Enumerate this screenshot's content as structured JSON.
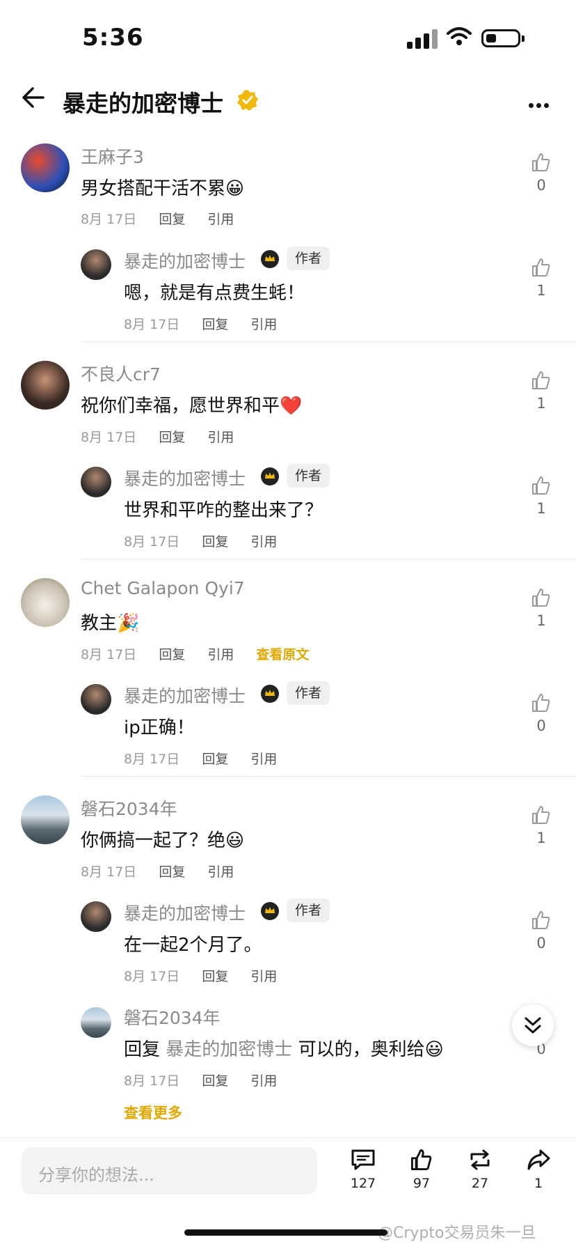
{
  "status_bar": {
    "time": "5:36"
  },
  "header": {
    "title": "暴走的加密博士"
  },
  "comments": [
    {
      "user": "王麻子3",
      "text": "男女搭配干活不累😀",
      "date": "8月 17日",
      "reply_label": "回复",
      "quote_label": "引用",
      "likes": "0",
      "reply": {
        "user": "暴走的加密博士",
        "tag": "作者",
        "text": "嗯，就是有点费生蚝！",
        "date": "8月 17日",
        "reply_label": "回复",
        "quote_label": "引用",
        "likes": "1"
      }
    },
    {
      "user": "不良人cr7",
      "text": "祝你们幸福，愿世界和平❤️",
      "date": "8月 17日",
      "reply_label": "回复",
      "quote_label": "引用",
      "likes": "1",
      "reply": {
        "user": "暴走的加密博士",
        "tag": "作者",
        "text": "世界和平咋的整出来了？",
        "date": "8月 17日",
        "reply_label": "回复",
        "quote_label": "引用",
        "likes": "1"
      }
    },
    {
      "user": "Chet Galapon Qyi7",
      "text": "教主🎉",
      "date": "8月 17日",
      "reply_label": "回复",
      "quote_label": "引用",
      "extra_label": "查看原文",
      "likes": "1",
      "reply": {
        "user": "暴走的加密博士",
        "tag": "作者",
        "text": "ip正确！",
        "date": "8月 17日",
        "reply_label": "回复",
        "quote_label": "引用",
        "likes": "0"
      }
    },
    {
      "user": "磐石2034年",
      "text": "你俩搞一起了？绝😃",
      "date": "8月 17日",
      "reply_label": "回复",
      "quote_label": "引用",
      "likes": "1",
      "reply": {
        "user": "暴走的加密博士",
        "tag": "作者",
        "text": "在一起2个月了。",
        "date": "8月 17日",
        "reply_label": "回复",
        "quote_label": "引用",
        "likes": "0"
      },
      "reply2": {
        "user": "磐石2034年",
        "prefix": "回复",
        "mention": "暴走的加密博士",
        "text": "可以的，奥利给😃",
        "date": "8月 17日",
        "reply_label": "回复",
        "quote_label": "引用",
        "likes": "0"
      }
    }
  ],
  "see_more": "查看更多",
  "bottom_bar": {
    "placeholder": "分享你的想法...",
    "comments_count": "127",
    "likes_count": "97",
    "reposts_count": "27",
    "shares_count": "1"
  },
  "watermark": "@Crypto交易员朱一旦",
  "colors": {
    "accent": "#e0a800",
    "verified": "#f0b90b"
  }
}
